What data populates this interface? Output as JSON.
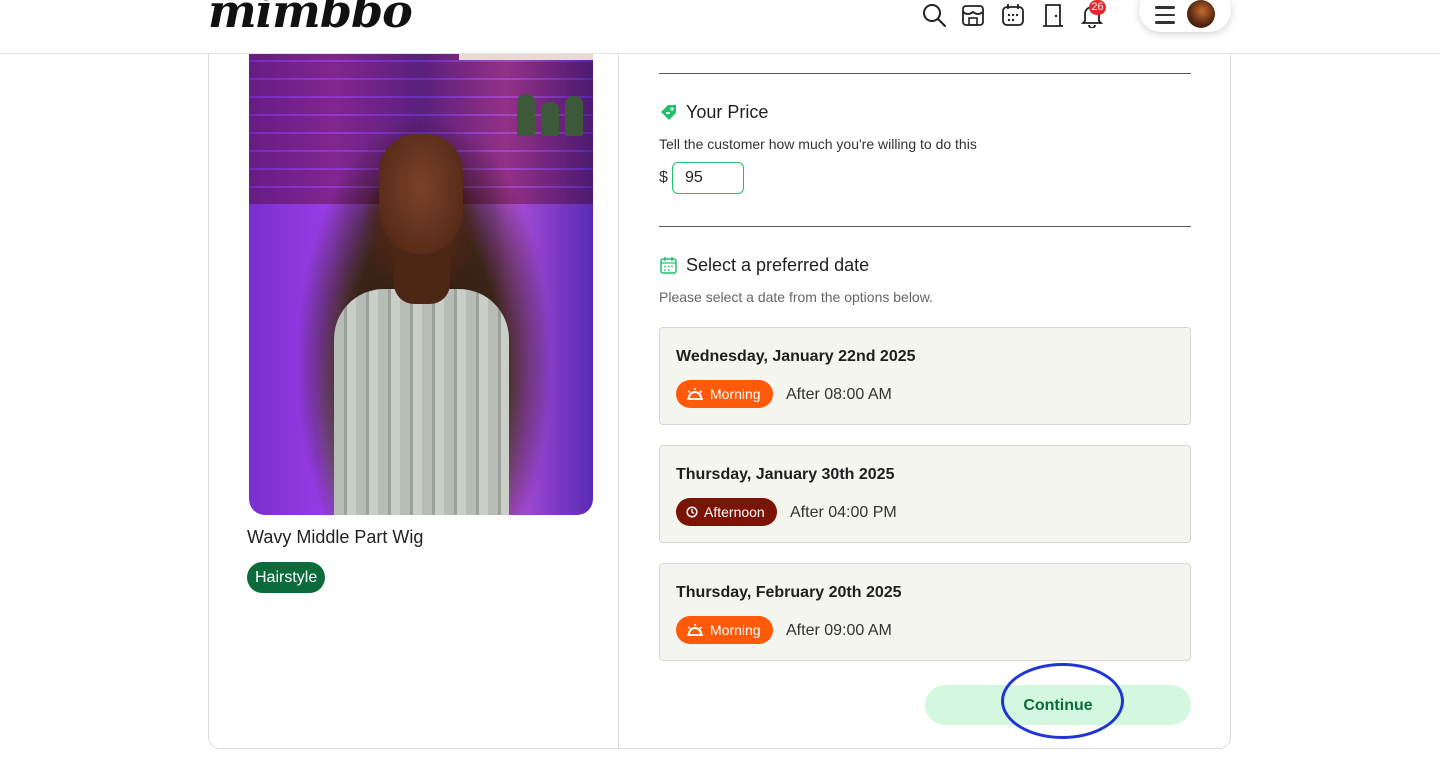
{
  "header": {
    "logo": "mimbbo",
    "notification_count": "26",
    "icons": [
      "search-icon",
      "store-icon",
      "calendar-icon",
      "door-icon",
      "bell-icon"
    ]
  },
  "product": {
    "title": "Wavy Middle Part Wig",
    "tag": "Hairstyle"
  },
  "price_section": {
    "title": "Your Price",
    "subtitle": "Tell the customer how much you're willing to do this",
    "currency": "$",
    "value": "95"
  },
  "date_section": {
    "title": "Select a preferred date",
    "subtitle": "Please select a date from the options below.",
    "options": [
      {
        "date": "Wednesday, January 22nd 2025",
        "slot": "Morning",
        "time": "After 08:00 AM"
      },
      {
        "date": "Thursday, January 30th 2025",
        "slot": "Afternoon",
        "time": "After 04:00 PM"
      },
      {
        "date": "Thursday, February 20th 2025",
        "slot": "Morning",
        "time": "After 09:00 AM"
      }
    ]
  },
  "actions": {
    "continue_label": "Continue"
  },
  "colors": {
    "brand_green": "#1fc16b",
    "dark_green": "#0b6b3a",
    "morning_orange": "#ff5a0a",
    "afternoon_maroon": "#7a1406",
    "highlight_blue": "#1f35d6"
  }
}
